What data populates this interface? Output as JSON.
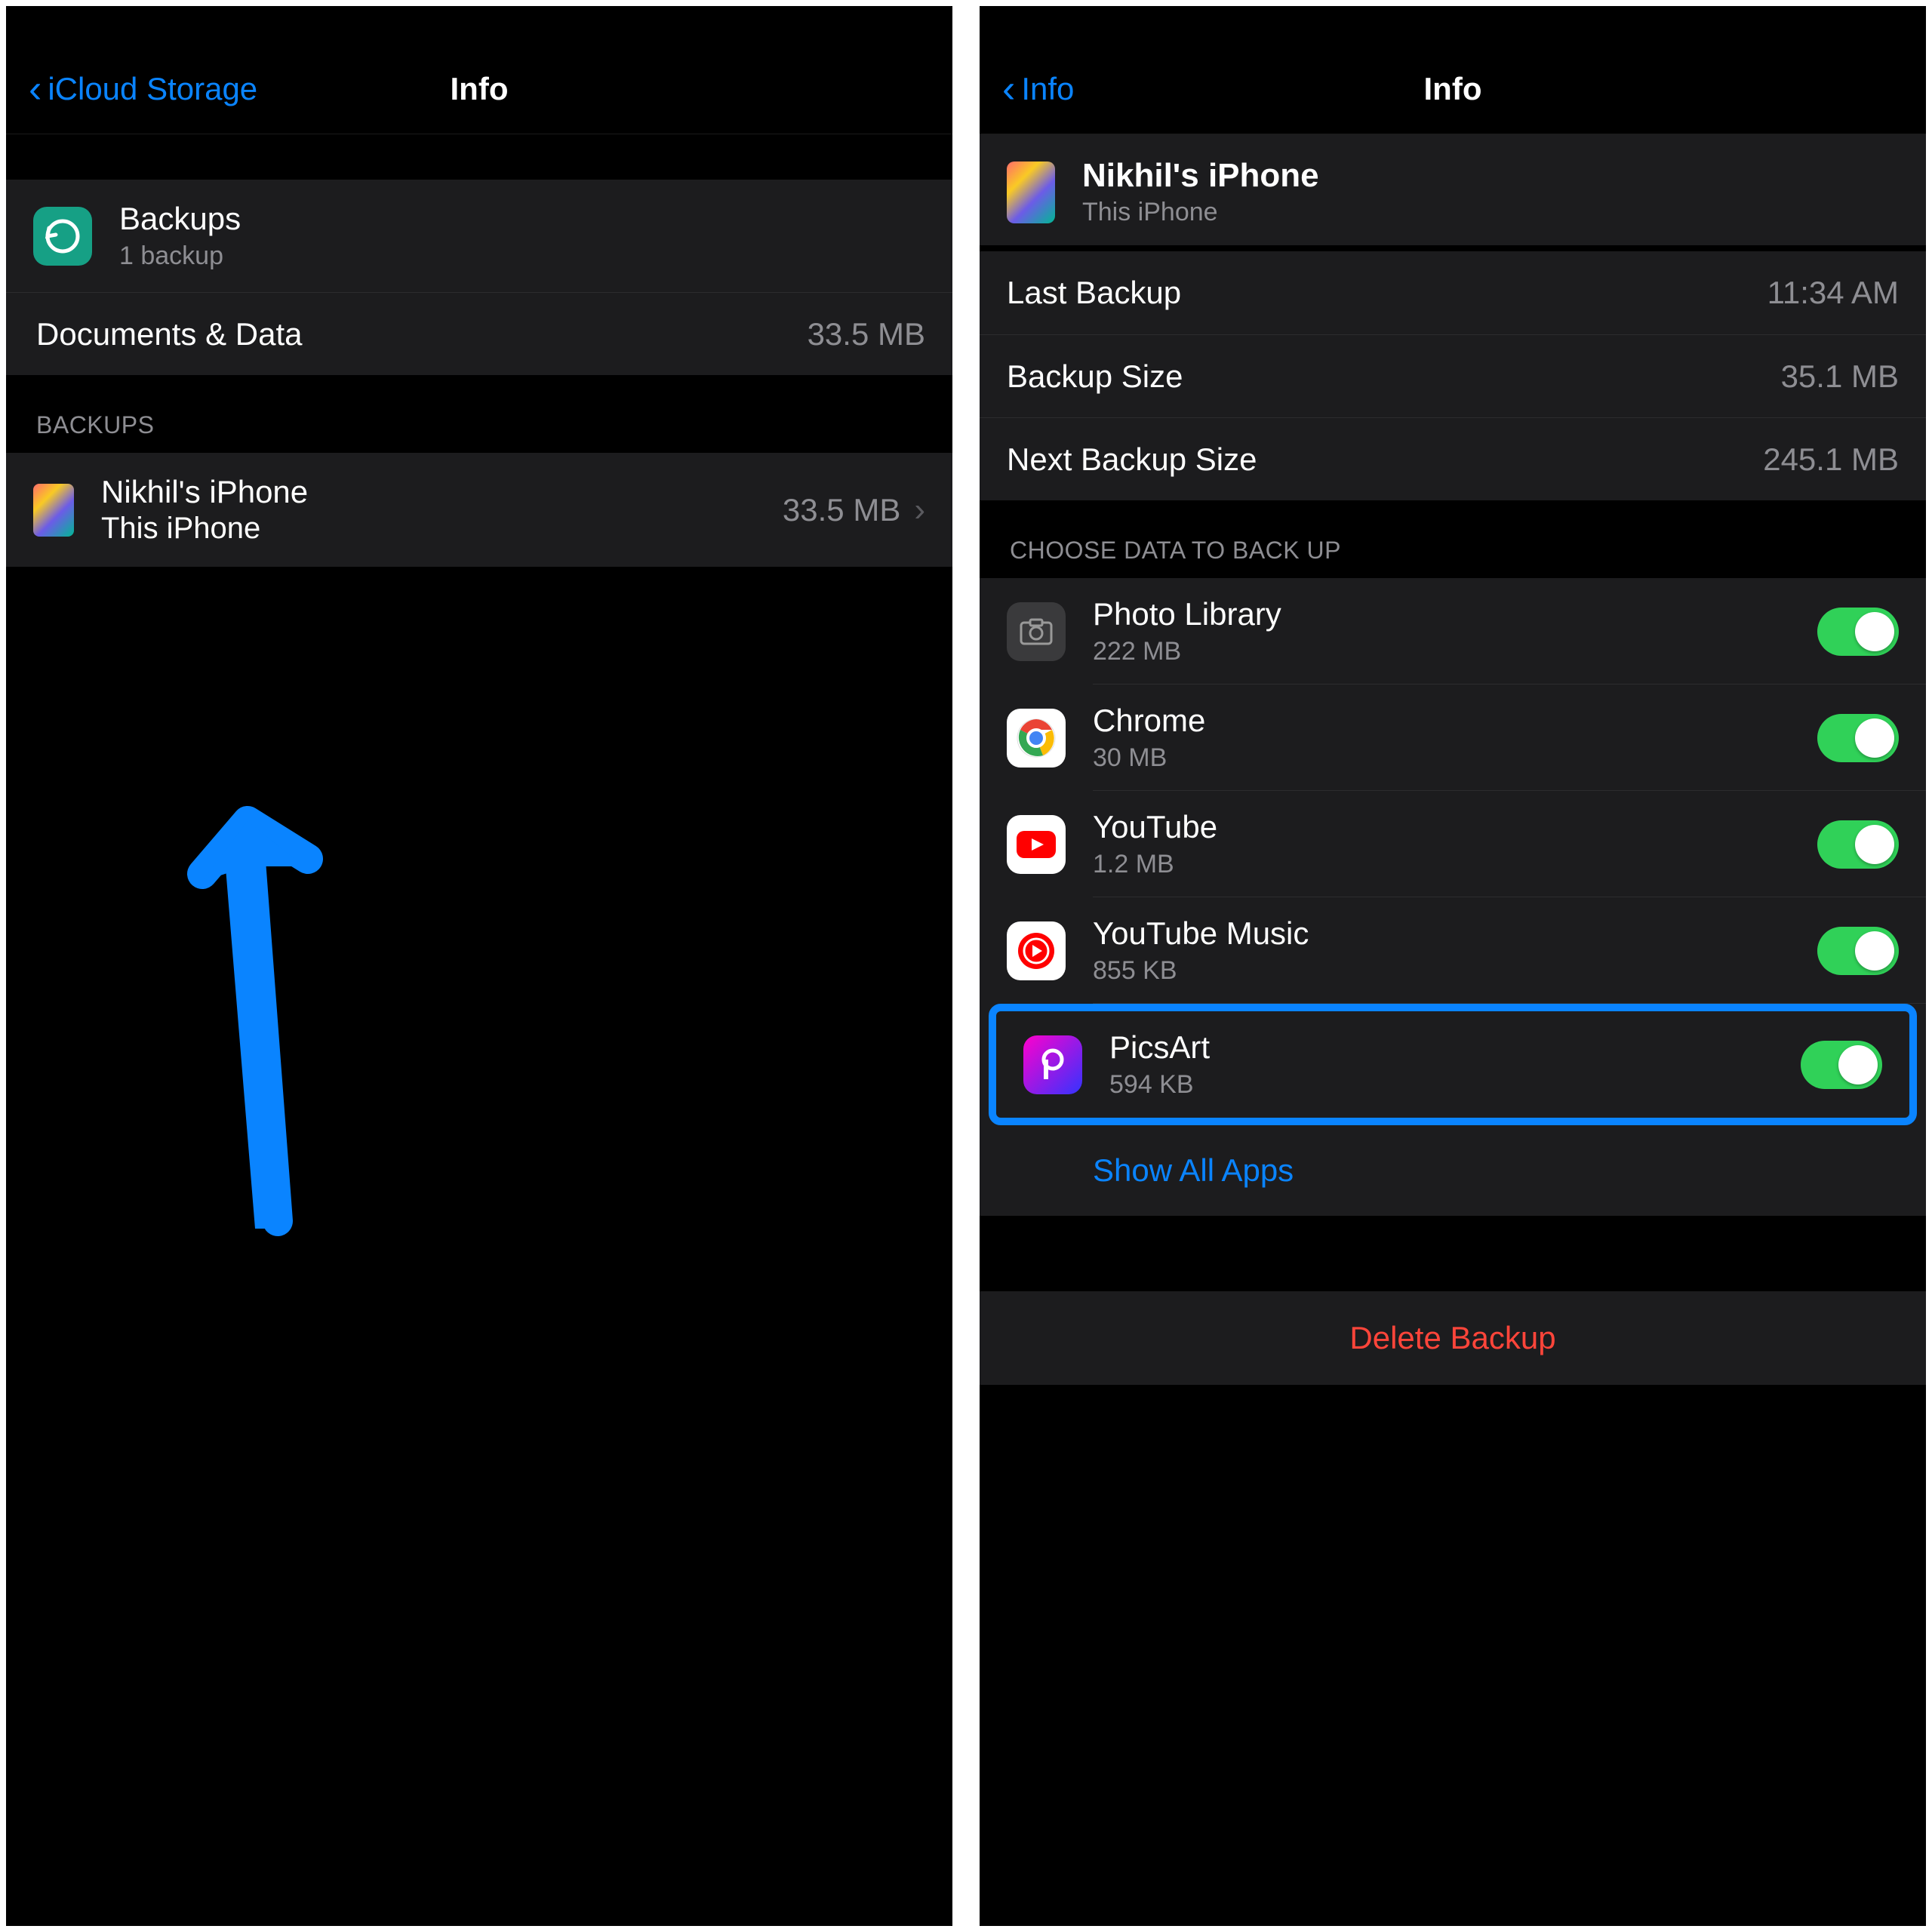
{
  "left": {
    "nav": {
      "back": "iCloud Storage",
      "title": "Info"
    },
    "backups": {
      "title": "Backups",
      "subtitle": "1 backup"
    },
    "documents": {
      "label": "Documents & Data",
      "value": "33.5 MB"
    },
    "sectionHeader": "BACKUPS",
    "device": {
      "name": "Nikhil's iPhone",
      "sub": "This iPhone",
      "size": "33.5 MB"
    }
  },
  "right": {
    "nav": {
      "back": "Info",
      "title": "Info"
    },
    "device": {
      "name": "Nikhil's iPhone",
      "sub": "This iPhone"
    },
    "stats": [
      {
        "label": "Last Backup",
        "value": "11:34 AM"
      },
      {
        "label": "Backup Size",
        "value": "35.1 MB"
      },
      {
        "label": "Next Backup Size",
        "value": "245.1 MB"
      }
    ],
    "chooseHeader": "CHOOSE DATA TO BACK UP",
    "apps": [
      {
        "name": "Photo Library",
        "size": "222 MB",
        "icon": "photo"
      },
      {
        "name": "Chrome",
        "size": "30 MB",
        "icon": "chrome"
      },
      {
        "name": "YouTube",
        "size": "1.2 MB",
        "icon": "youtube"
      },
      {
        "name": "YouTube Music",
        "size": "855 KB",
        "icon": "ytmusic"
      },
      {
        "name": "PicsArt",
        "size": "594 KB",
        "icon": "picsart"
      }
    ],
    "showAll": "Show All Apps",
    "delete": "Delete Backup"
  }
}
